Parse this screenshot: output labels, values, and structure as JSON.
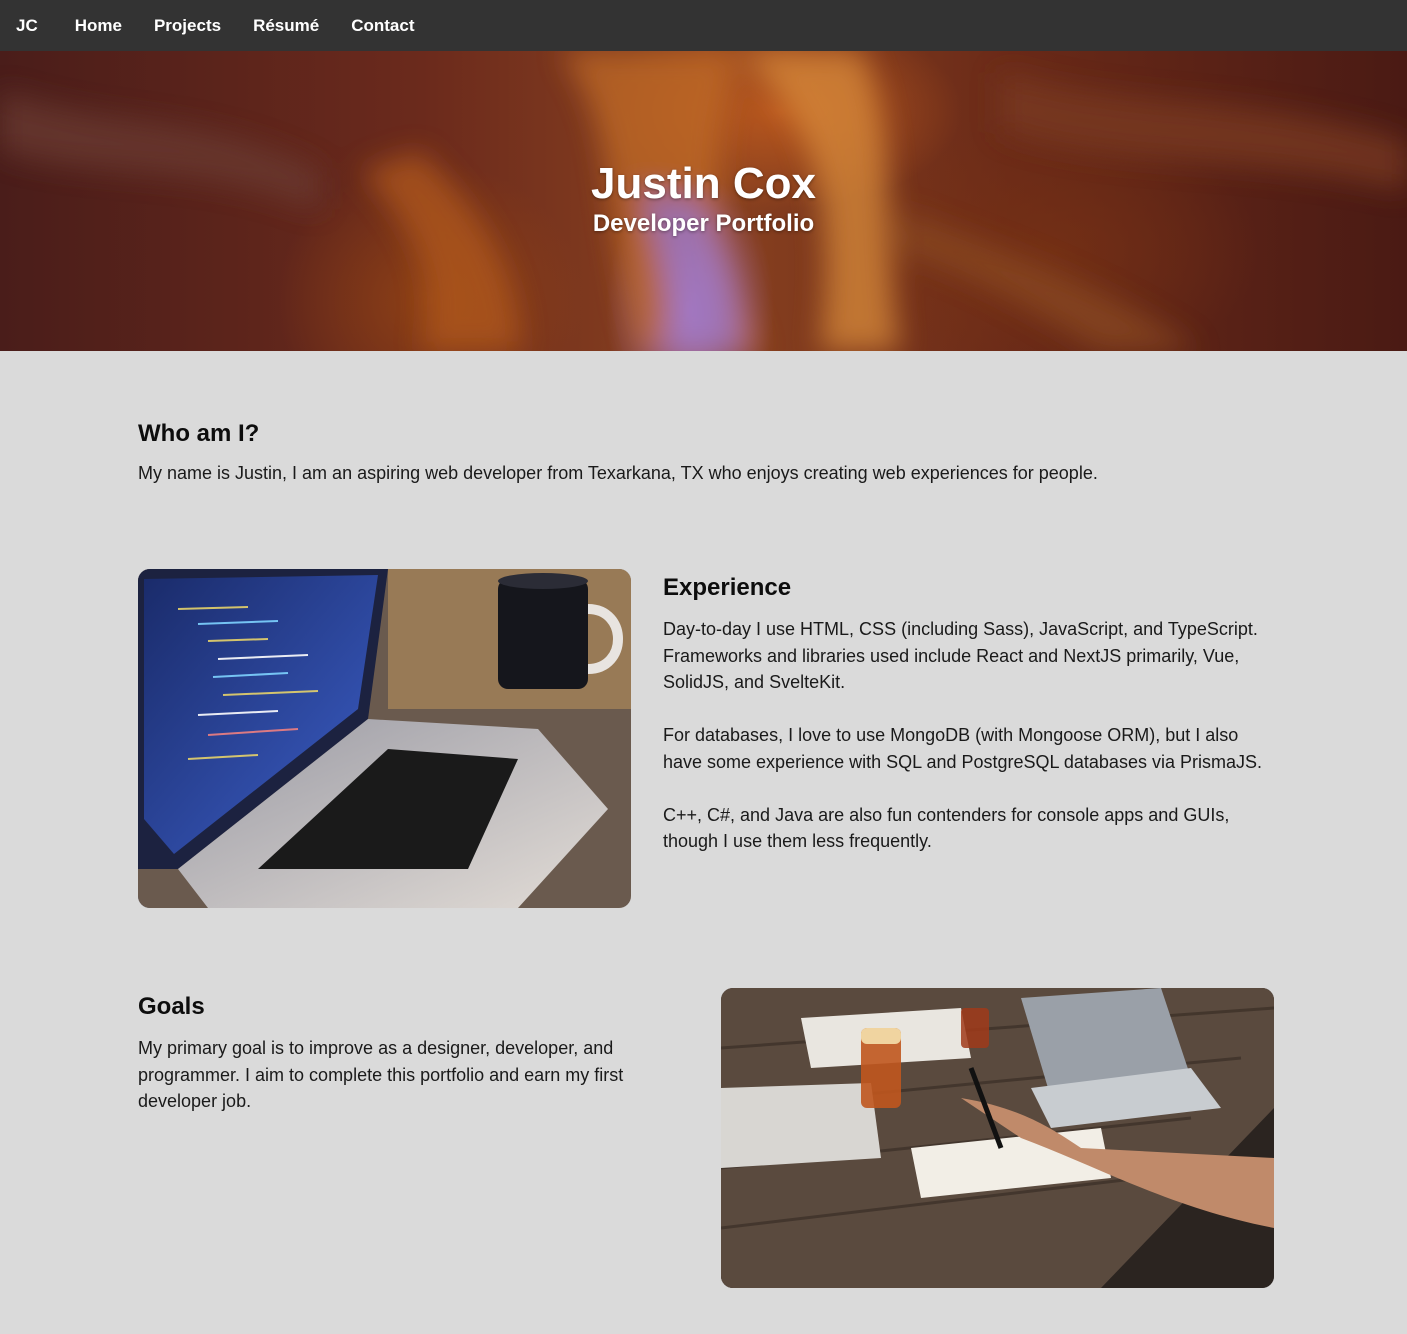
{
  "nav": {
    "brand": "JC",
    "items": [
      {
        "label": "Home"
      },
      {
        "label": "Projects"
      },
      {
        "label": "Résumé"
      },
      {
        "label": "Contact"
      }
    ]
  },
  "hero": {
    "title": "Justin Cox",
    "subtitle": "Developer Portfolio"
  },
  "about": {
    "heading": "Who am I?",
    "text": "My name is Justin, I am an aspiring web developer from Texarkana, TX who enjoys creating web experiences for people."
  },
  "experience": {
    "heading": "Experience",
    "paragraphs": [
      "Day-to-day I use HTML, CSS (including Sass), JavaScript, and TypeScript. Frameworks and libraries used include React and NextJS primarily, Vue, SolidJS, and SvelteKit.",
      "For databases, I love to use MongoDB (with Mongoose ORM), but I also have some experience with SQL and PostgreSQL databases via PrismaJS.",
      "C++, C#, and Java are also fun contenders for console apps and GUIs, though I use them less frequently."
    ]
  },
  "goals": {
    "heading": "Goals",
    "text": "My primary goal is to improve as a designer, developer, and programmer. I aim to complete this portfolio and earn my first developer job."
  },
  "colors": {
    "nav_bg": "#333333",
    "page_bg": "#dadada"
  }
}
